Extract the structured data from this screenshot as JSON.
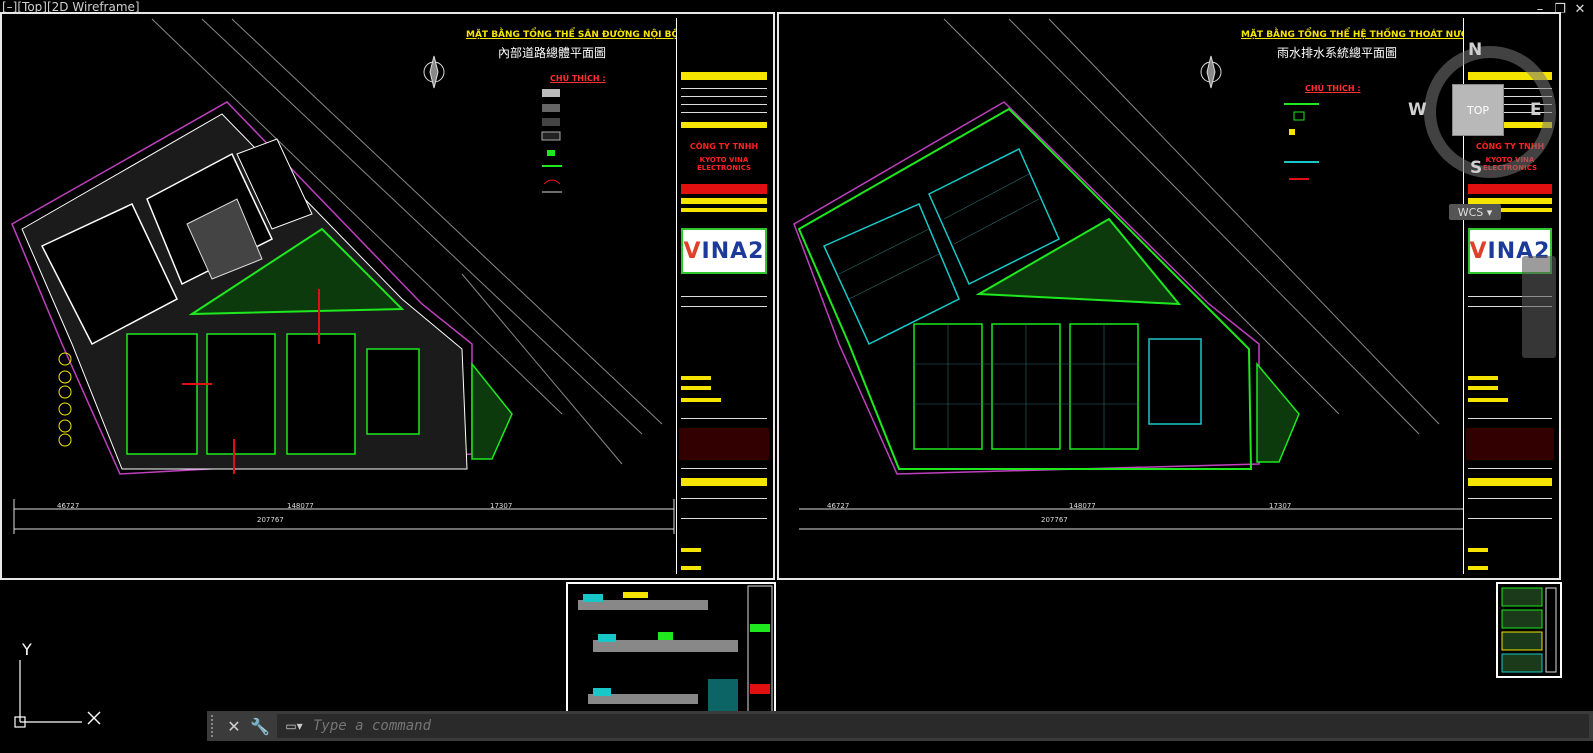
{
  "viewport": {
    "label": "[–][Top][2D Wireframe]",
    "controls": {
      "minimize": "–",
      "restore": "❐",
      "close": "✕"
    }
  },
  "left_sheet": {
    "title_vn": "MẶT BẰNG TỔNG THỂ SÂN ĐƯỜNG NỘI BỘ",
    "title_cn": "內部道路總體平面圖",
    "legend_title": "CHÚ THÍCH :",
    "company_line1": "CÔNG TY TNHH",
    "company_line2": "KYOTO VINA ELECTRONICS",
    "logo_text": "INA2",
    "logo_v": "V",
    "dim_total": "207767",
    "dim_left": "46727",
    "dim_mid": "148077",
    "dim_right": "17307"
  },
  "right_sheet": {
    "title_vn": "MẶT BẰNG TỔNG THỂ HỆ THỐNG THOÁT NƯỚC MƯA",
    "title_cn": "雨水排水系統總平面圖",
    "legend_title": "CHÚ THÍCH :",
    "company_line1": "CÔNG TY TNHH",
    "company_line2": "KYOTO VINA ELECTRONICS",
    "logo_text": "INA2",
    "logo_v": "V",
    "dim_total": "207767",
    "dim_left": "46727",
    "dim_mid": "148077",
    "dim_right": "17307"
  },
  "viewcube": {
    "north": "N",
    "south": "S",
    "west": "W",
    "east": "E",
    "face": "TOP",
    "wcs": "WCS ▾"
  },
  "ucs": {
    "x": "X",
    "y": "Y"
  },
  "command_line": {
    "placeholder": "Type a command",
    "close_icon": "✕",
    "wrench_icon": "🔧"
  },
  "colors": {
    "green": "#1ee81e",
    "yellow": "#f5e400",
    "red": "#e01010",
    "cyan": "#18c8c8",
    "magenta": "#c040c0"
  }
}
